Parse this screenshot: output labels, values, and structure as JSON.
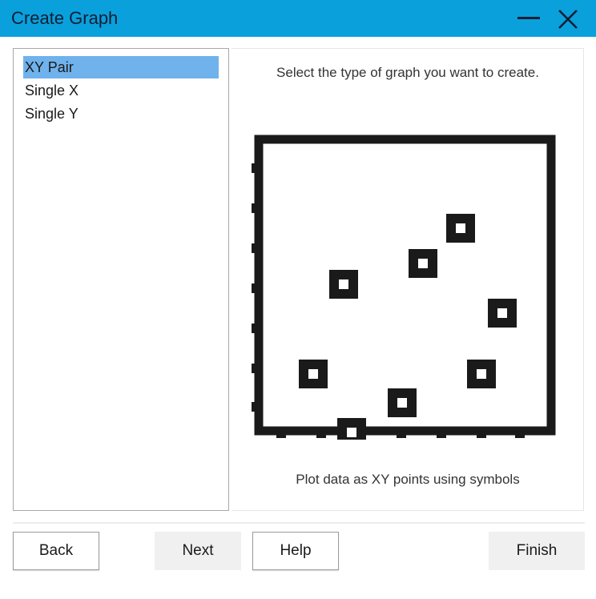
{
  "window": {
    "title": "Create Graph",
    "titlebar_color": "#0aa0dc",
    "controls": [
      "minimize-icon",
      "close-icon"
    ]
  },
  "graph_types": {
    "items": [
      {
        "label": "XY Pair",
        "selected": true
      },
      {
        "label": "Single X",
        "selected": false
      },
      {
        "label": "Single Y",
        "selected": false
      }
    ],
    "selection_color": "#6fb2ec"
  },
  "preview": {
    "instruction": "Select the type of graph you want to create.",
    "description": "Plot data as XY points using symbols",
    "illustration": "scatter-plot-icon"
  },
  "buttons": {
    "back": "Back",
    "next": "Next",
    "help": "Help",
    "finish": "Finish"
  }
}
